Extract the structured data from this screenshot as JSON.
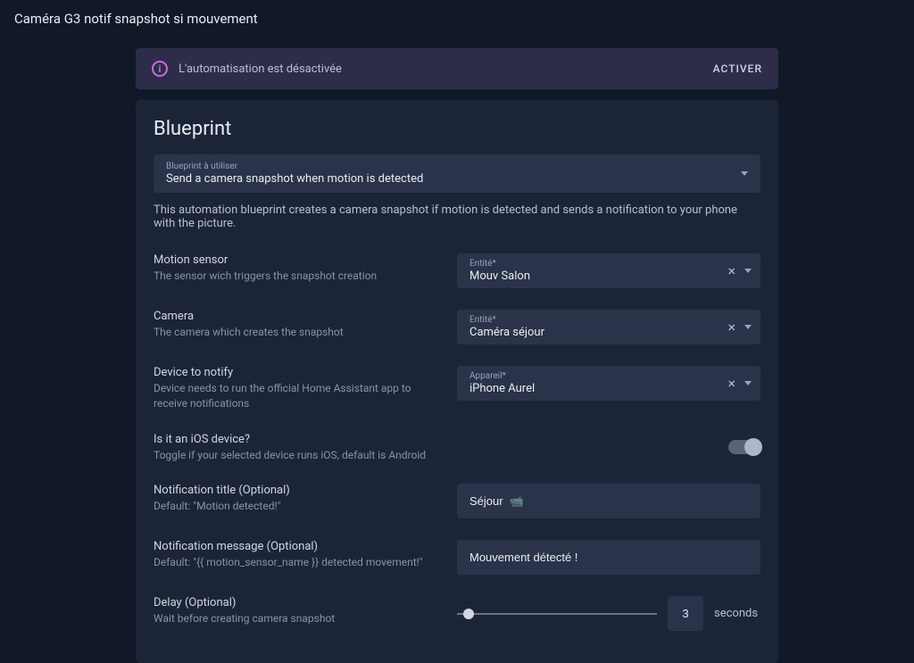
{
  "header": {
    "title": "Caméra G3 notif snapshot si mouvement"
  },
  "alert": {
    "message": "L'automatisation est désactivée",
    "action": "ACTIVER"
  },
  "card": {
    "title": "Blueprint",
    "blueprint_label": "Blueprint à utiliser",
    "blueprint_value": "Send a camera snapshot when motion is detected",
    "description": "This automation blueprint creates a camera snapshot if motion is detected and sends a notification to your phone with the picture."
  },
  "fields": {
    "motion": {
      "title": "Motion sensor",
      "desc": "The sensor wich triggers the snapshot creation",
      "label": "Entité*",
      "value": "Mouv Salon"
    },
    "camera": {
      "title": "Camera",
      "desc": "The camera which creates the snapshot",
      "label": "Entité*",
      "value": "Caméra séjour"
    },
    "device": {
      "title": "Device to notify",
      "desc": "Device needs to run the official Home Assistant app to receive notifications",
      "label": "Appareil*",
      "value": "iPhone Aurel"
    },
    "ios": {
      "title": "Is it an iOS device?",
      "desc": "Toggle if your selected device runs iOS, default is Android"
    },
    "notif_title": {
      "title": "Notification title (Optional)",
      "desc": "Default: \"Motion detected!\"",
      "value": "Séjour  📹"
    },
    "notif_msg": {
      "title": "Notification message (Optional)",
      "desc": "Default: \"{{ motion_sensor_name }} detected movement!\"",
      "value": "Mouvement détecté !"
    },
    "delay": {
      "title": "Delay (Optional)",
      "desc": "Wait before creating camera snapshot",
      "value": "3",
      "unit": "seconds"
    }
  }
}
